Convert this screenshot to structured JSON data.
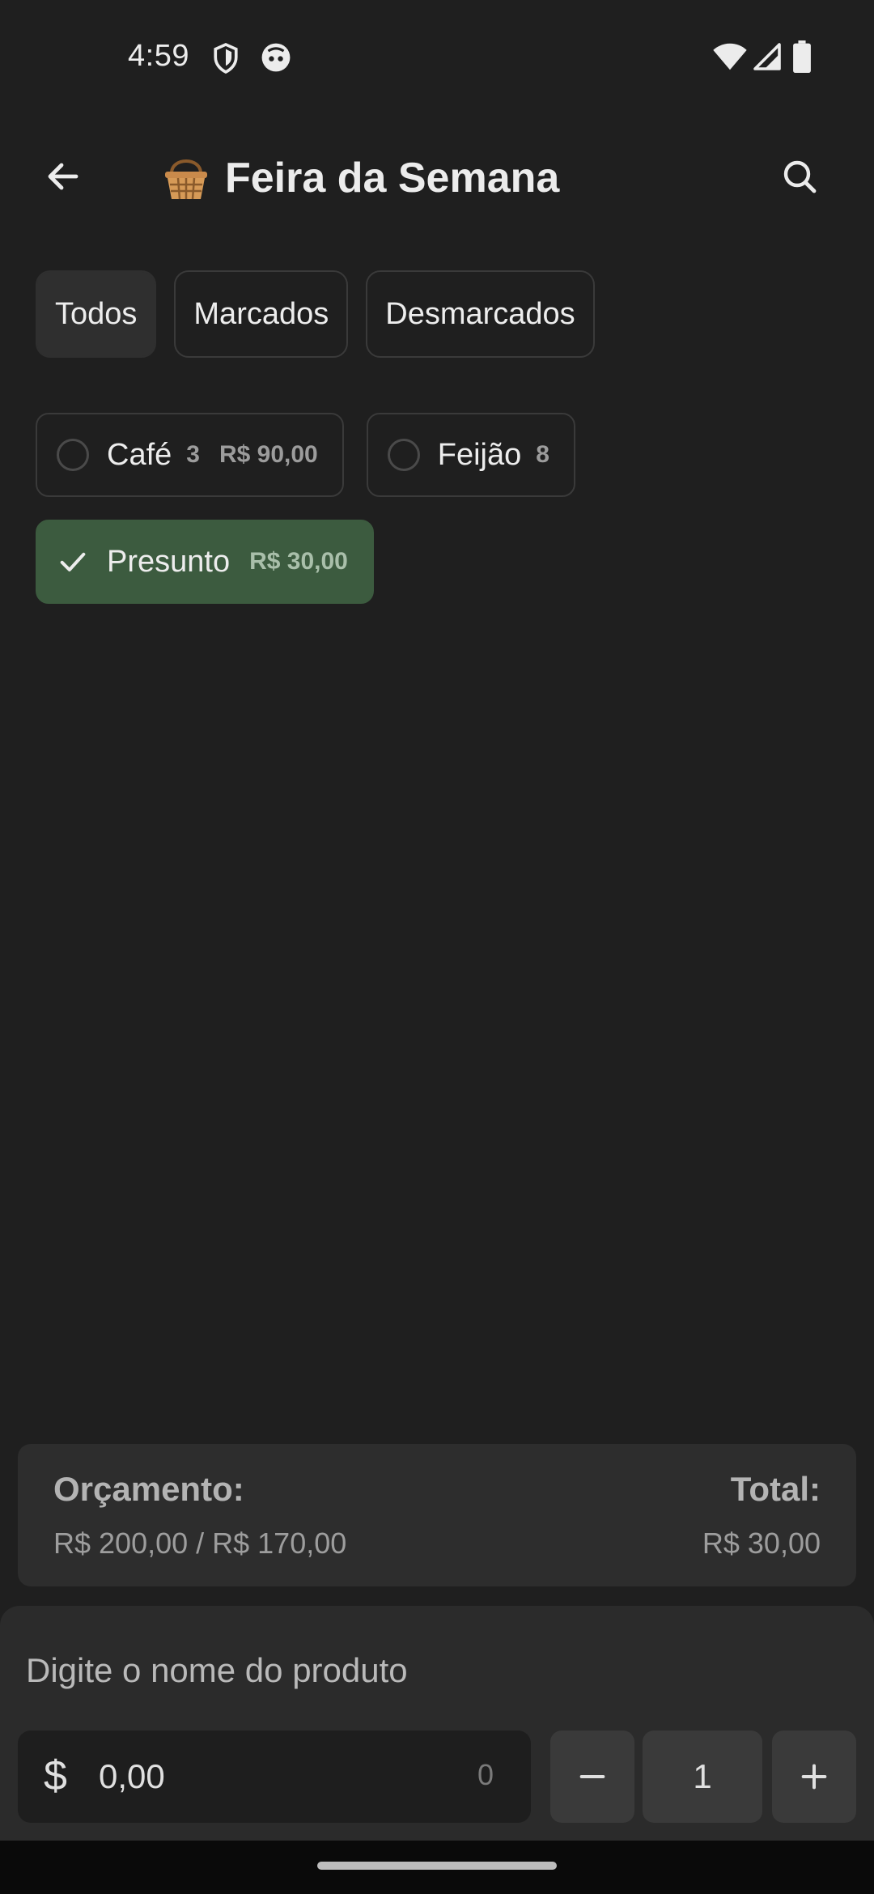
{
  "status_bar": {
    "time": "4:59",
    "icons": [
      "shield-icon",
      "app-notification-icon",
      "wifi-icon",
      "cell-signal-icon",
      "battery-icon"
    ]
  },
  "app_bar": {
    "title": "Feira da Semana",
    "title_icon": "basket-icon",
    "back_icon": "arrow-back-icon",
    "search_icon": "search-icon"
  },
  "filters": [
    {
      "label": "Todos",
      "selected": true
    },
    {
      "label": "Marcados",
      "selected": false
    },
    {
      "label": "Desmarcados",
      "selected": false
    }
  ],
  "products": [
    {
      "name": "Café",
      "qty": "3",
      "price": "R$ 90,00",
      "checked": false
    },
    {
      "name": "Feijão",
      "qty": "8",
      "price": "",
      "checked": false
    },
    {
      "name": "Presunto",
      "qty": "",
      "price": "R$ 30,00",
      "checked": true
    }
  ],
  "budget": {
    "label": "Orçamento:",
    "value": "R$ 200,00 / R$ 170,00",
    "total_label": "Total:",
    "total_value": "R$ 30,00"
  },
  "input": {
    "product_placeholder": "Digite o nome do produto",
    "currency_symbol": "$",
    "price_value": "0,00",
    "cents_counter": "0",
    "quantity": "1",
    "decrement_label": "−",
    "increment_label": "+"
  },
  "colors": {
    "background": "#1f1f1f",
    "checked_chip": "#3c5b3f",
    "card": "#2d2d2d"
  }
}
